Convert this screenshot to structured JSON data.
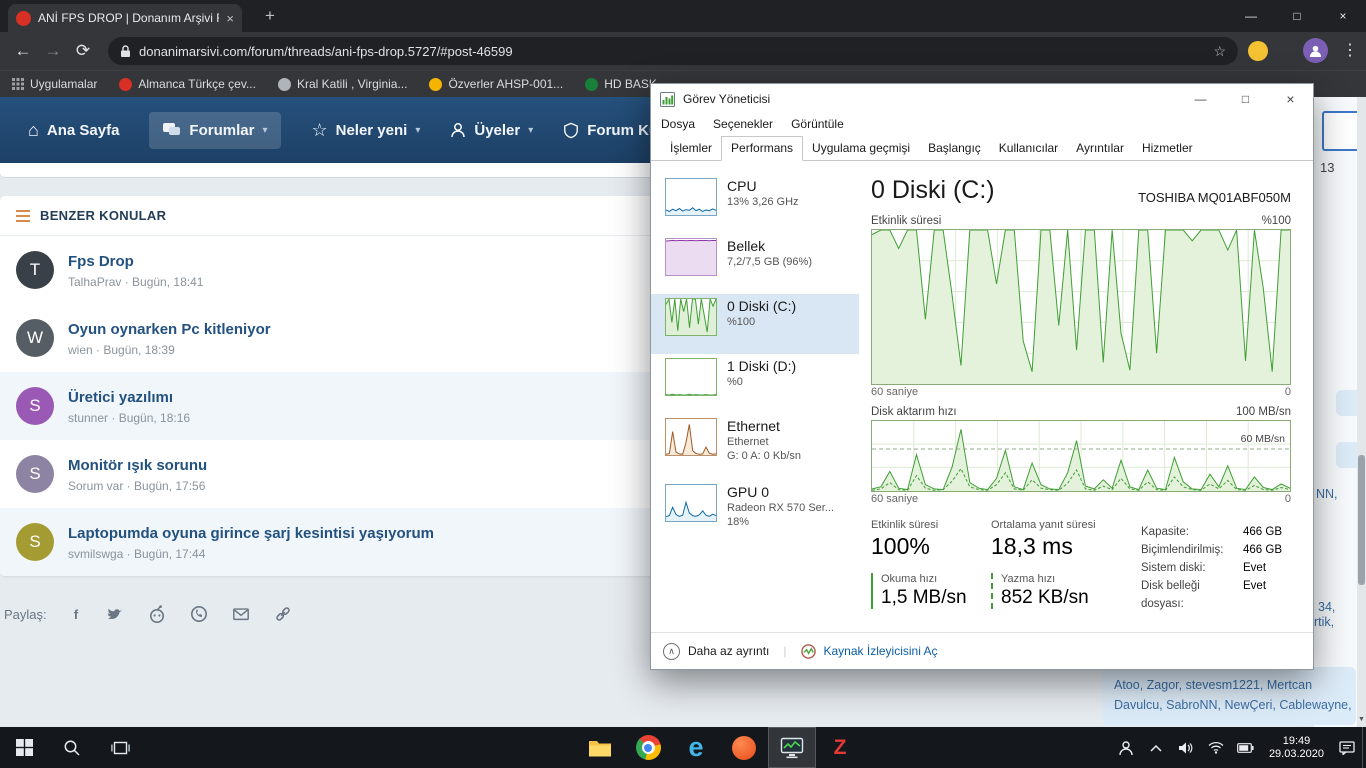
{
  "glyphs": {
    "close": "×",
    "minimize": "—",
    "maximize": "□",
    "plus": "+",
    "back": "←",
    "forward": "→",
    "refresh": "⟳",
    "star": "☆",
    "dots": "⋮",
    "caret": "▾",
    "home": "⌂",
    "star_nav": "☆",
    "chevron_up": "∧",
    "scroll_down": "▼",
    "pipe": "|",
    "edge_e": "e",
    "z_letter": "Z"
  },
  "browser": {
    "tab_title": "ANİ FPS DROP | Donanım Arşivi F",
    "url": "donanimarsivi.com/forum/threads/ani-fps-drop.5727/#post-46599",
    "bookmarks": [
      {
        "label": "Uygulamalar"
      },
      {
        "label": "Almanca Türkçe çev...",
        "icon_style": "background:#d93025"
      },
      {
        "label": "Kral Katili , Virginia...",
        "icon_style": "background:#aeb4ba"
      },
      {
        "label": "Özverler AHSP-001...",
        "icon_style": "background:#f4b400"
      },
      {
        "label": "HD BASK...",
        "icon_style": "background:#188038"
      }
    ]
  },
  "forum": {
    "nav": [
      {
        "label": "Ana Sayfa"
      },
      {
        "label": "Forumlar"
      },
      {
        "label": "Neler yeni"
      },
      {
        "label": "Üyeler"
      },
      {
        "label": "Forum Kurall"
      }
    ],
    "similar": {
      "header": "BENZER KONULAR",
      "threads": [
        {
          "initial": "T",
          "avatar_style": "background:#3a4047",
          "title": "Fps Drop",
          "meta": "TalhaPrav · Bugün, 18:41"
        },
        {
          "initial": "W",
          "avatar_style": "background:#565d64",
          "title": "Oyun oynarken Pc kitleniyor",
          "meta": "wien · Bugün, 18:39"
        },
        {
          "initial": "S",
          "avatar_style": "background:#9b59b6",
          "title": "Üretici yazılımı",
          "meta": "stunner · Bugün, 18:16"
        },
        {
          "initial": "S",
          "avatar_style": "background:#8d83a2",
          "title": "Monitör ışık sorunu",
          "meta": "Sorum var · Bugün, 17:56"
        },
        {
          "initial": "S",
          "avatar_style": "background:#a59b33",
          "title": "Laptopumda oyuna girince şarj kesintisi yaşıyorum",
          "meta": "svmilswga · Bugün, 17:44"
        }
      ],
      "share_label": "Paylaş:"
    },
    "fragments": {
      "count": "13",
      "edge1": "NN,",
      "edge2": "34,",
      "edge3": "rtik,",
      "members_line1": "Atoo, Zagor, stevesm1221, Mertcan",
      "members_line2": "Davulcu, SabroNN, NewÇeri, Cablewayne,"
    }
  },
  "taskmanager": {
    "title": "Görev Yöneticisi",
    "menu": [
      {
        "label": "Dosya"
      },
      {
        "label": "Seçenekler"
      },
      {
        "label": "Görüntüle"
      }
    ],
    "tabs": [
      {
        "label": "İşlemler"
      },
      {
        "label": "Performans"
      },
      {
        "label": "Uygulama geçmişi"
      },
      {
        "label": "Başlangıç"
      },
      {
        "label": "Kullanıcılar"
      },
      {
        "label": "Ayrıntılar"
      },
      {
        "label": "Hizmetler"
      }
    ],
    "sidebar": [
      {
        "name": "CPU",
        "sub1": "13% 3,26 GHz"
      },
      {
        "name": "Bellek",
        "sub1": "7,2/7,5 GB (96%)"
      },
      {
        "name": "0 Diski (C:)",
        "sub1": "%100"
      },
      {
        "name": "1 Diski (D:)",
        "sub1": "%0"
      },
      {
        "name": "Ethernet",
        "sub1": "Ethernet",
        "sub2": "G: 0 A: 0 Kb/sn"
      },
      {
        "name": "GPU 0",
        "sub1": "Radeon RX 570 Ser...",
        "sub2": "18%"
      }
    ],
    "main": {
      "title": "0 Diski (C:)",
      "device": "TOSHIBA MQ01ABF050M",
      "chart1_label": "Etkinlik süresi",
      "chart1_max": "%100",
      "chart1_xleft": "60 saniye",
      "chart1_xright": "0",
      "chart2_label": "Disk aktarım hızı",
      "chart2_max": "100 MB/sn",
      "chart2_inner": "60 MB/sn",
      "chart2_xleft": "60 saniye",
      "chart2_xright": "0",
      "stats": [
        {
          "label": "Etkinlik süresi",
          "value": "100%"
        },
        {
          "label": "Ortalama yanıt süresi",
          "value": "18,3 ms"
        },
        {
          "label": "Okuma hızı",
          "value": "1,5 MB/sn"
        },
        {
          "label": "Yazma hızı",
          "value": "852 KB/sn"
        }
      ],
      "details": [
        {
          "label": "Kapasite:",
          "value": "466 GB"
        },
        {
          "label": "Biçimlendirilmiş:",
          "value": "466 GB"
        },
        {
          "label": "Sistem diski:",
          "value": "Evet"
        },
        {
          "label": "Disk belleği dosyası:",
          "value": "Evet"
        }
      ]
    },
    "footer": {
      "less_detail": "Daha az ayrıntı",
      "resource_link": "Kaynak İzleyicisini Aç"
    }
  },
  "taskbar": {
    "time": "19:49",
    "date": "29.03.2020"
  },
  "charts": {
    "disk_active": {
      "values": [
        97,
        100,
        100,
        88,
        100,
        100,
        42,
        100,
        100,
        58,
        12,
        100,
        100,
        100,
        65,
        100,
        100,
        28,
        8,
        100,
        100,
        38,
        100,
        22,
        100,
        100,
        14,
        100,
        33,
        9,
        100,
        100,
        20,
        100,
        100,
        100,
        93,
        100,
        100,
        100,
        87,
        100,
        15,
        100,
        62,
        8,
        100,
        100
      ]
    },
    "disk_read": {
      "values": [
        3,
        6,
        28,
        4,
        2,
        52,
        9,
        3,
        2,
        34,
        88,
        12,
        4,
        2,
        18,
        58,
        6,
        2,
        40,
        9,
        3,
        2,
        26,
        72,
        7,
        3,
        16,
        4,
        44,
        6,
        2,
        30,
        4,
        2,
        48,
        13,
        3,
        2,
        24,
        6,
        36,
        4,
        2,
        20,
        5,
        2,
        10,
        4
      ]
    },
    "disk_write": {
      "values": [
        1,
        3,
        12,
        2,
        1,
        22,
        4,
        1,
        2,
        14,
        32,
        6,
        2,
        1,
        9,
        26,
        3,
        1,
        16,
        4,
        2,
        1,
        11,
        30,
        3,
        1,
        7,
        2,
        18,
        3,
        1,
        13,
        2,
        1,
        20,
        6,
        2,
        1,
        10,
        3,
        15,
        2,
        1,
        8,
        2,
        1,
        5,
        2
      ]
    },
    "mini_cpu": {
      "values": [
        14,
        10,
        16,
        12,
        18,
        11,
        15,
        13,
        20,
        12,
        16,
        10,
        14,
        12,
        17,
        13
      ]
    },
    "mini_mem": {
      "values": [
        94,
        95,
        96,
        95,
        96,
        96,
        95,
        96,
        96,
        95,
        96,
        96,
        96,
        95,
        96,
        96
      ]
    },
    "mini_diskc": {
      "values": [
        85,
        100,
        35,
        100,
        12,
        100,
        65,
        100,
        20,
        100,
        100,
        30,
        100,
        55,
        8,
        100,
        80,
        100
      ]
    },
    "mini_diskd": {
      "values": [
        1,
        0,
        2,
        0,
        1,
        0,
        0,
        2,
        0,
        1,
        0,
        0,
        1,
        0,
        0,
        1
      ]
    },
    "mini_eth": {
      "values": [
        2,
        4,
        65,
        8,
        3,
        2,
        35,
        85,
        12,
        4,
        2,
        3,
        22,
        5,
        2,
        3
      ]
    },
    "mini_gpu": {
      "values": [
        12,
        15,
        38,
        18,
        13,
        16,
        52,
        22,
        15,
        13,
        17,
        28,
        16,
        13,
        19,
        15
      ]
    }
  }
}
